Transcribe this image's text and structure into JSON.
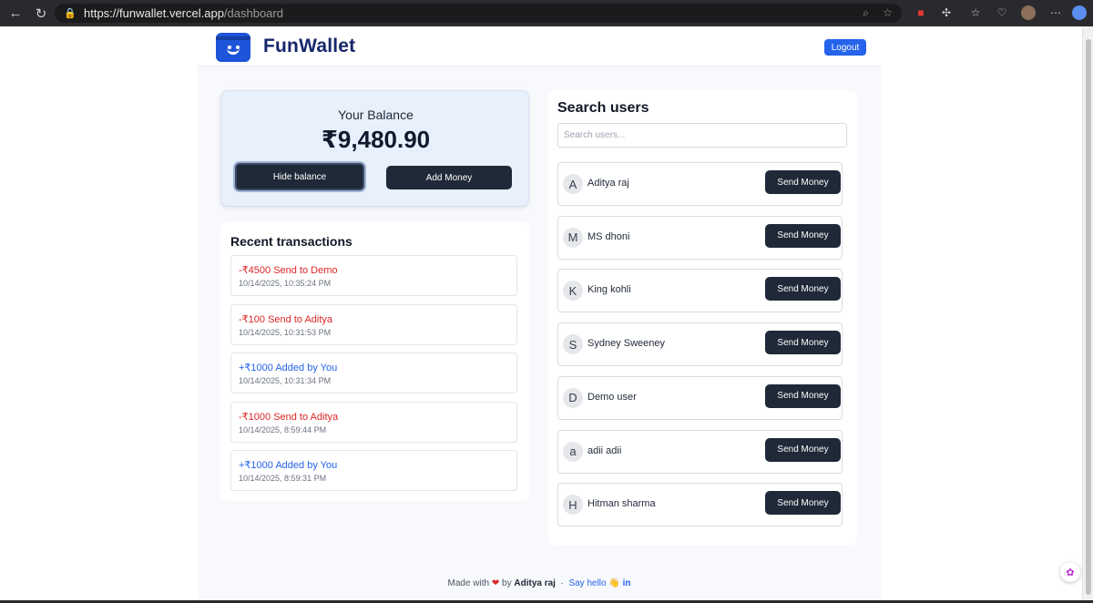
{
  "browser": {
    "url_host": "https://funwallet.vercel.app",
    "url_path": "/dashboard"
  },
  "header": {
    "brand": "FunWallet",
    "logout_label": "Logout"
  },
  "balance": {
    "label": "Your Balance",
    "amount": "₹9,480.90",
    "hide_label": "Hide balance",
    "add_label": "Add Money"
  },
  "transactions": {
    "title": "Recent transactions",
    "items": [
      {
        "desc": "-₹4500 Send to Demo",
        "time": "10/14/2025, 10:35:24 PM",
        "type": "debit"
      },
      {
        "desc": "-₹100 Send to Aditya",
        "time": "10/14/2025, 10:31:53 PM",
        "type": "debit"
      },
      {
        "desc": "+₹1000 Added by You",
        "time": "10/14/2025, 10:31:34 PM",
        "type": "credit"
      },
      {
        "desc": "-₹1000 Send to Aditya",
        "time": "10/14/2025, 8:59:44 PM",
        "type": "debit"
      },
      {
        "desc": "+₹1000 Added by You",
        "time": "10/14/2025, 8:59:31 PM",
        "type": "credit"
      }
    ]
  },
  "search": {
    "title": "Search users",
    "placeholder": "Search users...",
    "send_label": "Send Money",
    "users": [
      {
        "initial": "A",
        "name": "Aditya raj"
      },
      {
        "initial": "M",
        "name": "MS dhoni"
      },
      {
        "initial": "K",
        "name": "King kohli"
      },
      {
        "initial": "S",
        "name": "Sydney Sweeney"
      },
      {
        "initial": "D",
        "name": "Demo user"
      },
      {
        "initial": "a",
        "name": "adii adii"
      },
      {
        "initial": "H",
        "name": "Hitman sharma"
      }
    ]
  },
  "footer": {
    "made_with": "Made with",
    "by": "by",
    "author": "Aditya raj",
    "separator": "·",
    "say_hello": "Say hello 👋",
    "linkedin": "in"
  },
  "colors": {
    "accent": "#2563eb",
    "brand": "#16276b",
    "debit": "#dc2626",
    "credit": "#2563eb",
    "button_dark": "#1f2937"
  }
}
